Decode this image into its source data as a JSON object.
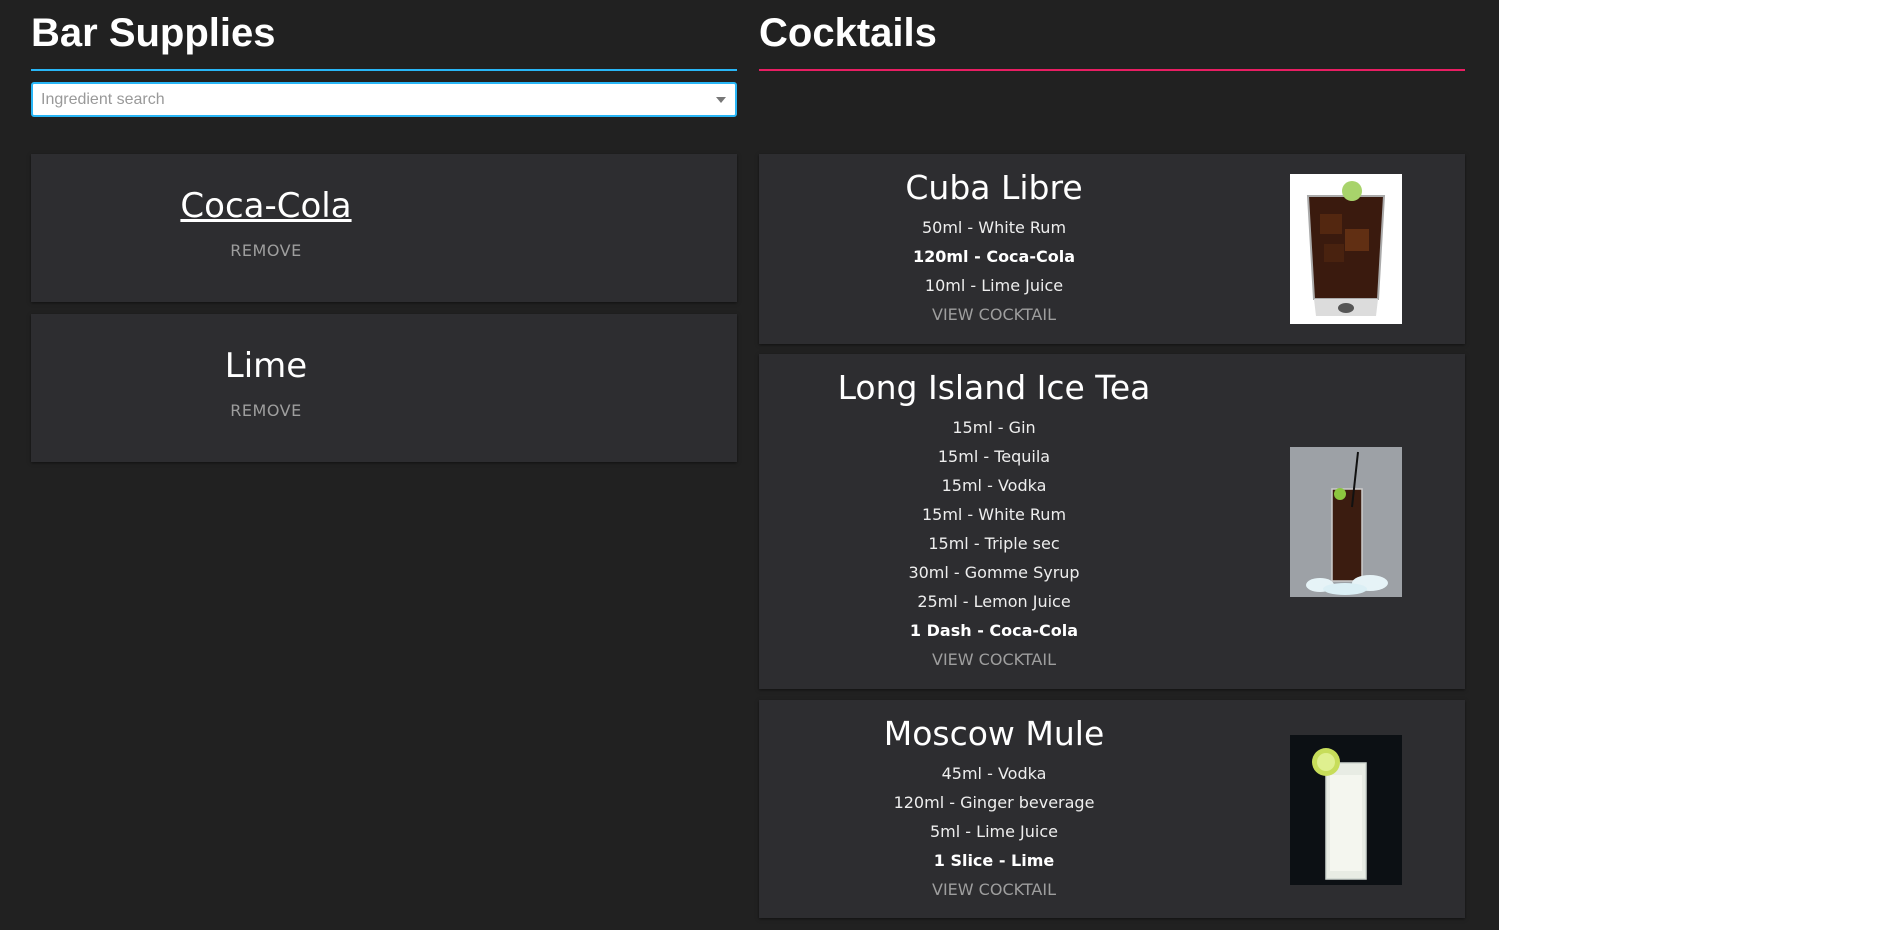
{
  "supplies": {
    "title": "Bar Supplies",
    "search_placeholder": "Ingredient search",
    "items": [
      {
        "name": "Coca-Cola",
        "remove_label": "REMOVE"
      },
      {
        "name": "Lime",
        "remove_label": "REMOVE"
      }
    ]
  },
  "cocktails": {
    "title": "Cocktails",
    "items": [
      {
        "name": "Cuba Libre",
        "ingredients": [
          "50ml - White Rum",
          "120ml - Coca-Cola",
          "10ml - Lime Juice"
        ],
        "owned": [
          false,
          true,
          false
        ],
        "view_label": "VIEW COCKTAIL",
        "image": "cola-rocks-glass-image"
      },
      {
        "name": "Long Island Ice Tea",
        "ingredients": [
          "15ml - Gin",
          "15ml - Tequila",
          "15ml - Vodka",
          "15ml - White Rum",
          "15ml - Triple sec",
          "30ml - Gomme Syrup",
          "25ml - Lemon Juice",
          "1 Dash - Coca-Cola"
        ],
        "owned": [
          false,
          false,
          false,
          false,
          false,
          false,
          false,
          true
        ],
        "view_label": "VIEW COCKTAIL",
        "image": "long-island-highball-image"
      },
      {
        "name": "Moscow Mule",
        "ingredients": [
          "45ml - Vodka",
          "120ml - Ginger beverage",
          "5ml - Lime Juice",
          "1 Slice - Lime"
        ],
        "owned": [
          false,
          false,
          false,
          true
        ],
        "view_label": "VIEW COCKTAIL",
        "image": "moscow-mule-glass-image"
      }
    ]
  },
  "colors": {
    "background": "#212121",
    "card": "#2d2d30",
    "supplies_accent": "#29b6f6",
    "cocktails_accent": "#e91e63"
  }
}
